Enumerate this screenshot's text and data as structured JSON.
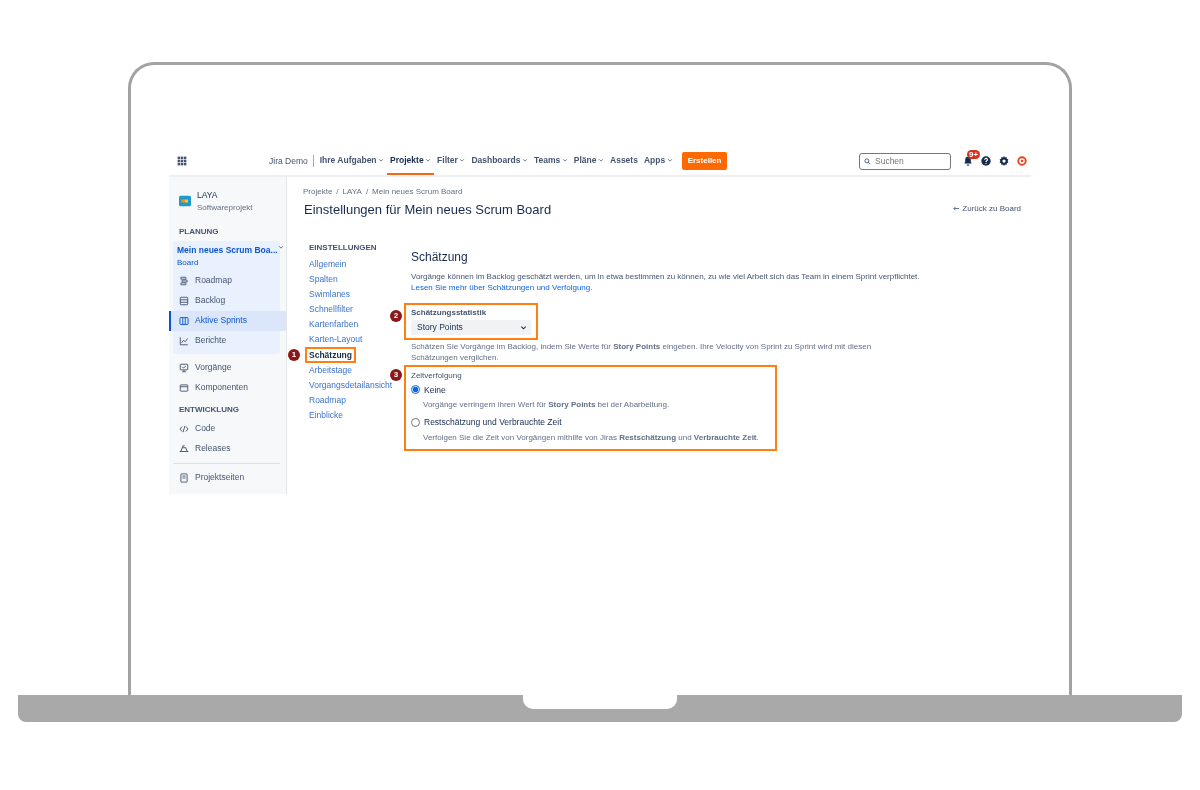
{
  "topnav": {
    "site": "Jira Demo",
    "items": [
      {
        "label": "Ihre Aufgaben",
        "dropdown": true,
        "selected": false
      },
      {
        "label": "Projekte",
        "dropdown": true,
        "selected": true
      },
      {
        "label": "Filter",
        "dropdown": true,
        "selected": false
      },
      {
        "label": "Dashboards",
        "dropdown": true,
        "selected": false
      },
      {
        "label": "Teams",
        "dropdown": true,
        "selected": false
      },
      {
        "label": "Pläne",
        "dropdown": true,
        "selected": false
      },
      {
        "label": "Assets",
        "dropdown": false,
        "selected": false
      },
      {
        "label": "Apps",
        "dropdown": true,
        "selected": false
      }
    ],
    "create_button": "Erstellen",
    "search": {
      "placeholder": "Suchen"
    },
    "notifications_badge": "9+"
  },
  "sidebar": {
    "project_name": "LAYA",
    "project_type": "Softwareprojekt",
    "groups": [
      {
        "heading": "PLANUNG",
        "board_name": "Mein neues Scrum Boa...",
        "board_type": "Board",
        "items": [
          {
            "label": "Roadmap",
            "selected": false
          },
          {
            "label": "Backlog",
            "selected": false
          },
          {
            "label": "Aktive Sprints",
            "selected": true
          },
          {
            "label": "Berichte",
            "selected": false
          }
        ]
      },
      {
        "items": [
          {
            "label": "Vorgänge",
            "selected": false
          },
          {
            "label": "Komponenten",
            "selected": false
          }
        ]
      },
      {
        "heading": "ENTWICKLUNG",
        "items": [
          {
            "label": "Code",
            "selected": false
          },
          {
            "label": "Releases",
            "selected": false
          }
        ]
      },
      {
        "items": [
          {
            "label": "Projektseiten",
            "selected": false
          }
        ]
      }
    ]
  },
  "breadcrumb": {
    "separator": "/",
    "items": [
      "Projekte",
      "LAYA",
      "Mein neues Scrum Board"
    ]
  },
  "title": "Einstellungen für Mein neues Scrum Board",
  "back_link": "Zurück zu Board",
  "settings_nav": {
    "heading": "EINSTELLUNGEN",
    "items": [
      {
        "label": "Allgemein",
        "selected": false
      },
      {
        "label": "Spalten",
        "selected": false
      },
      {
        "label": "Swimlanes",
        "selected": false
      },
      {
        "label": "Schnellfilter",
        "selected": false
      },
      {
        "label": "Kartenfarben",
        "selected": false
      },
      {
        "label": "Karten-Layout",
        "selected": false
      },
      {
        "label": "Schätzung",
        "selected": true,
        "marker": "1"
      },
      {
        "label": "Arbeitstage",
        "selected": false
      },
      {
        "label": "Vorgangsdetailansicht",
        "selected": false
      },
      {
        "label": "Roadmap",
        "selected": false
      },
      {
        "label": "Einblicke",
        "selected": false
      }
    ]
  },
  "section": {
    "title": "Schätzung",
    "description": "Vorgänge können im Backlog geschätzt werden, um in etwa bestimmen zu können, zu wie viel Arbeit sich das Team in einem Sprint verpflichtet.",
    "link": "Lesen Sie mehr über Schätzungen und Verfolgung.",
    "estimation": {
      "marker": "2",
      "label": "Schätzungsstatistik",
      "value": "Story Points",
      "help": "Schätzen Sie Vorgänge im Backlog, indem Sie Werte für **Story Points** eingeben. Ihre Velocity von Sprint zu Sprint wird mit diesen Schätzungen verglichen."
    },
    "time_tracking": {
      "marker": "3",
      "label": "Zeitverfolgung",
      "options": [
        {
          "label": "Keine",
          "selected": true,
          "help": "Vorgänge verringern ihren Wert für **Story Points** bei der Abarbeitung."
        },
        {
          "label": "Restschätzung und Verbrauchte Zeit",
          "selected": false,
          "help": "Verfolgen Sie die Zeit von Vorgängen mithilfe von Jiras **Restschätzung** und **Verbrauchte Zeit**."
        }
      ]
    }
  }
}
